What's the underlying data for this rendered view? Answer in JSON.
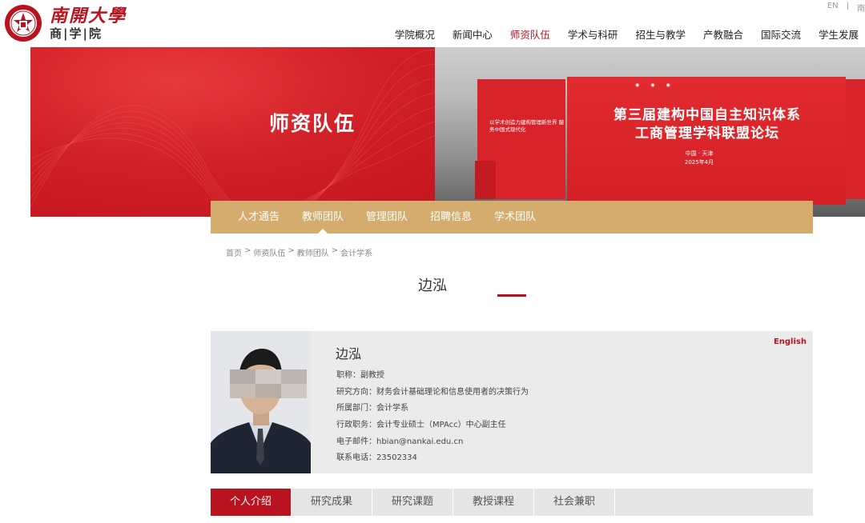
{
  "header": {
    "logo_title": "南開大學",
    "logo_subtitle": "商|学|院",
    "lang": [
      "EN",
      "|",
      "南"
    ],
    "nav": [
      {
        "label": "学院概况",
        "active": false
      },
      {
        "label": "新闻中心",
        "active": false
      },
      {
        "label": "师资队伍",
        "active": true
      },
      {
        "label": "学术与科研",
        "active": false
      },
      {
        "label": "招生与教学",
        "active": false
      },
      {
        "label": "产教融合",
        "active": false
      },
      {
        "label": "国际交流",
        "active": false
      },
      {
        "label": "学生发展",
        "active": false
      }
    ]
  },
  "banner": {
    "title": "师资队伍",
    "stage_main_line1": "第三届建构中国自主知识体系",
    "stage_main_line2": "工商管理学科联盟论坛",
    "stage_left_text": "以学术创造力建构管理新世界 服务中国式现代化",
    "stage_location_line1": "中国 · 天津",
    "stage_location_line2": "2025年4月"
  },
  "subnav": [
    {
      "label": "人才通告",
      "active": false
    },
    {
      "label": "教师团队",
      "active": true
    },
    {
      "label": "管理团队",
      "active": false
    },
    {
      "label": "招聘信息",
      "active": false
    },
    {
      "label": "学术团队",
      "active": false
    }
  ],
  "breadcrumb": [
    "首页",
    ">",
    "师资队伍",
    ">",
    "教师团队",
    ">",
    "会计学系"
  ],
  "page_title": "边泓",
  "profile": {
    "name": "边泓",
    "english_link": "English",
    "info": [
      "职称：副教授",
      "研究方向：财务会计基础理论和信息使用者的决策行为",
      "所属部门：会计学系",
      "行政职务：会计专业硕士（MPAcc）中心副主任",
      "电子邮件：hbian@nankai.edu.cn",
      "联系电话：23502334"
    ]
  },
  "tabs": [
    {
      "label": "个人介绍",
      "active": true
    },
    {
      "label": "研究成果",
      "active": false
    },
    {
      "label": "研究课题",
      "active": false
    },
    {
      "label": "教授课程",
      "active": false
    },
    {
      "label": "社会兼职",
      "active": false
    }
  ],
  "colors": {
    "brand_red": "#b8131e",
    "subnav_gold": "#d4ac6e",
    "card_gray": "#ebebeb"
  }
}
